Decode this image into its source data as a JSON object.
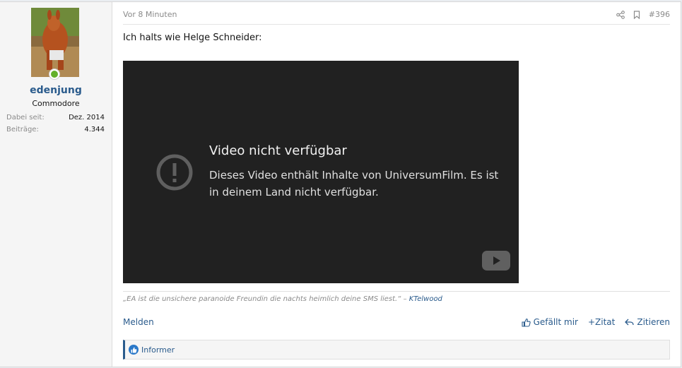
{
  "user": {
    "name": "edenjung",
    "title": "Commodore",
    "stats": [
      {
        "label": "Dabei seit:",
        "value": "Dez. 2014"
      },
      {
        "label": "Beiträge:",
        "value": "4.344"
      }
    ],
    "online": true
  },
  "post": {
    "time": "Vor 8 Minuten",
    "number": "#396",
    "text": "Ich halts wie Helge Schneider:",
    "video": {
      "title": "Video nicht verfügbar",
      "message": "Dieses Video enthält Inhalte von UniversumFilm. Es ist in deinem Land nicht verfügbar."
    },
    "signature": {
      "quote": "„EA ist die unsichere paranoide Freundin die nachts heimlich deine SMS liest.“ – ",
      "author": "KTelwood"
    },
    "actions": {
      "report": "Melden",
      "like": "Gefällt mir",
      "quote_add": "+Zitat",
      "reply": "Zitieren"
    },
    "reactions": {
      "users": "Informer"
    }
  },
  "colors": {
    "link": "#2a5b8c",
    "online": "#63b02a",
    "video_bg": "#212121"
  }
}
